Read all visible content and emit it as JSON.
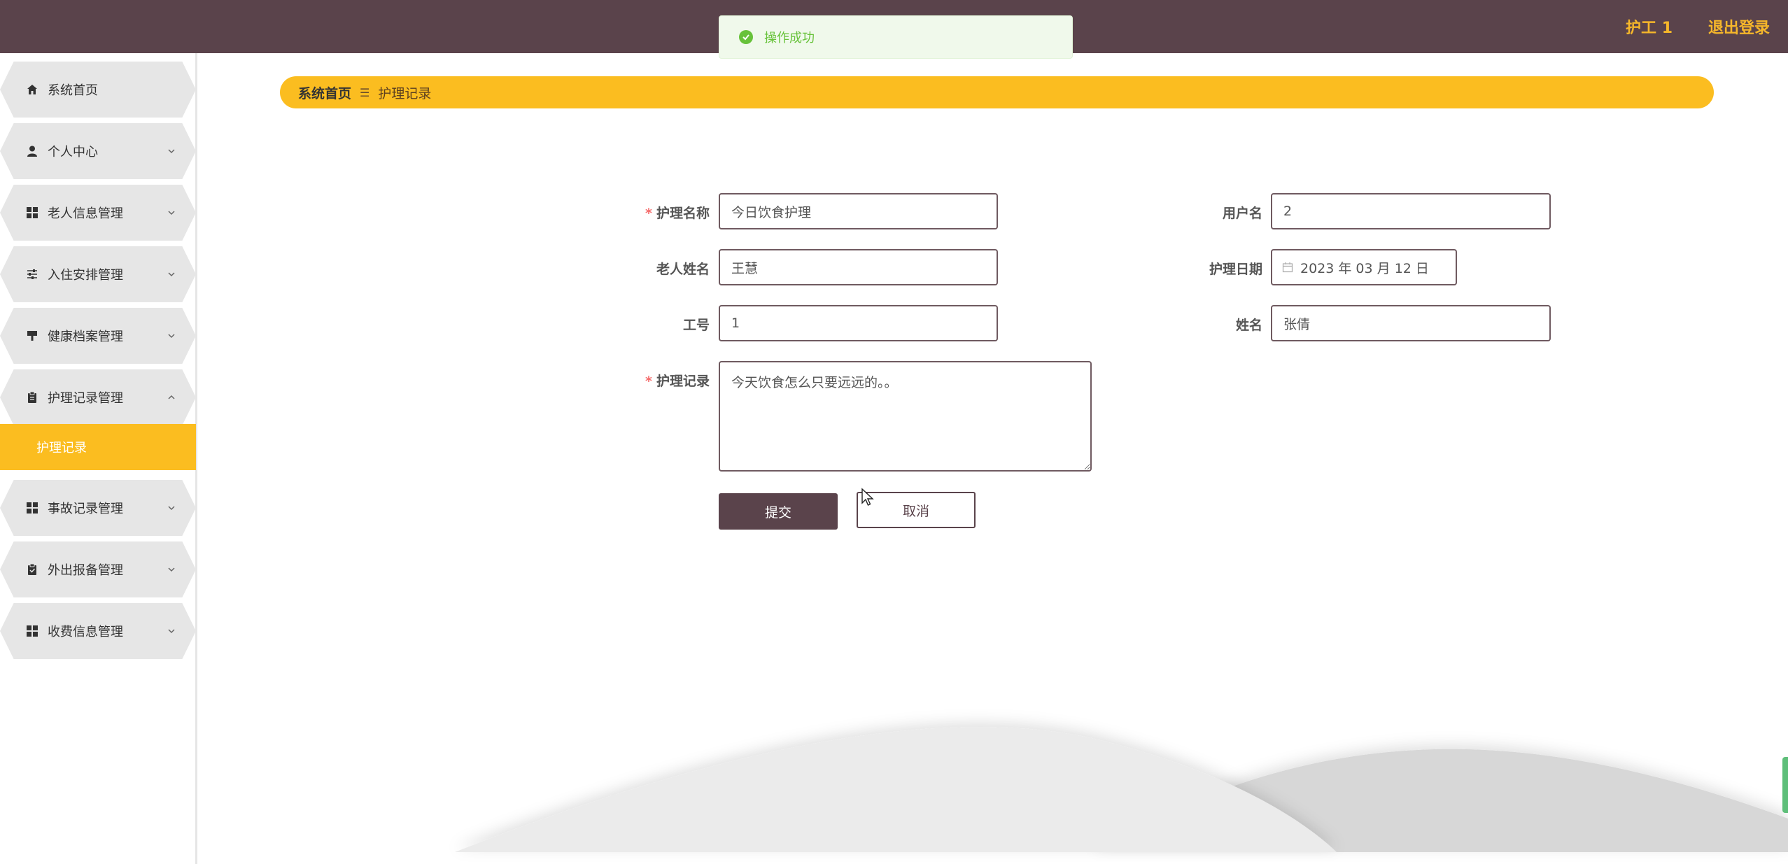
{
  "header": {
    "user": "护工 1",
    "logout": "退出登录"
  },
  "toast": {
    "message": "操作成功"
  },
  "sidebar": {
    "items": [
      {
        "label": "系统首页",
        "icon": "home-icon"
      },
      {
        "label": "个人中心",
        "icon": "user-icon"
      },
      {
        "label": "老人信息管理",
        "icon": "grid-icon"
      },
      {
        "label": "入住安排管理",
        "icon": "sliders-icon"
      },
      {
        "label": "健康档案管理",
        "icon": "brush-icon"
      },
      {
        "label": "护理记录管理",
        "icon": "clipboard-icon"
      },
      {
        "label": "事故记录管理",
        "icon": "grid-icon"
      },
      {
        "label": "外出报备管理",
        "icon": "clipboard-check-icon"
      },
      {
        "label": "收费信息管理",
        "icon": "grid-icon"
      }
    ],
    "active_sub": "护理记录"
  },
  "breadcrumb": {
    "home": "系统首页",
    "separator": "☰",
    "current": "护理记录"
  },
  "form": {
    "care_name": {
      "label": "护理名称",
      "value": "今日饮食护理"
    },
    "username": {
      "label": "用户名",
      "value": "2"
    },
    "elder_name": {
      "label": "老人姓名",
      "value": "王慧"
    },
    "care_date": {
      "label": "护理日期",
      "value": "2023 年 03 月 12 日"
    },
    "work_no": {
      "label": "工号",
      "value": "1"
    },
    "name": {
      "label": "姓名",
      "value": "张倩"
    },
    "care_record": {
      "label": "护理记录",
      "value": "今天饮食怎么只要远远的。。"
    },
    "submit": "提交",
    "cancel": "取消"
  },
  "colors": {
    "header_bg": "#5a434b",
    "accent": "#fbbd20",
    "header_text": "#f6b72a",
    "success": "#67c23a"
  }
}
